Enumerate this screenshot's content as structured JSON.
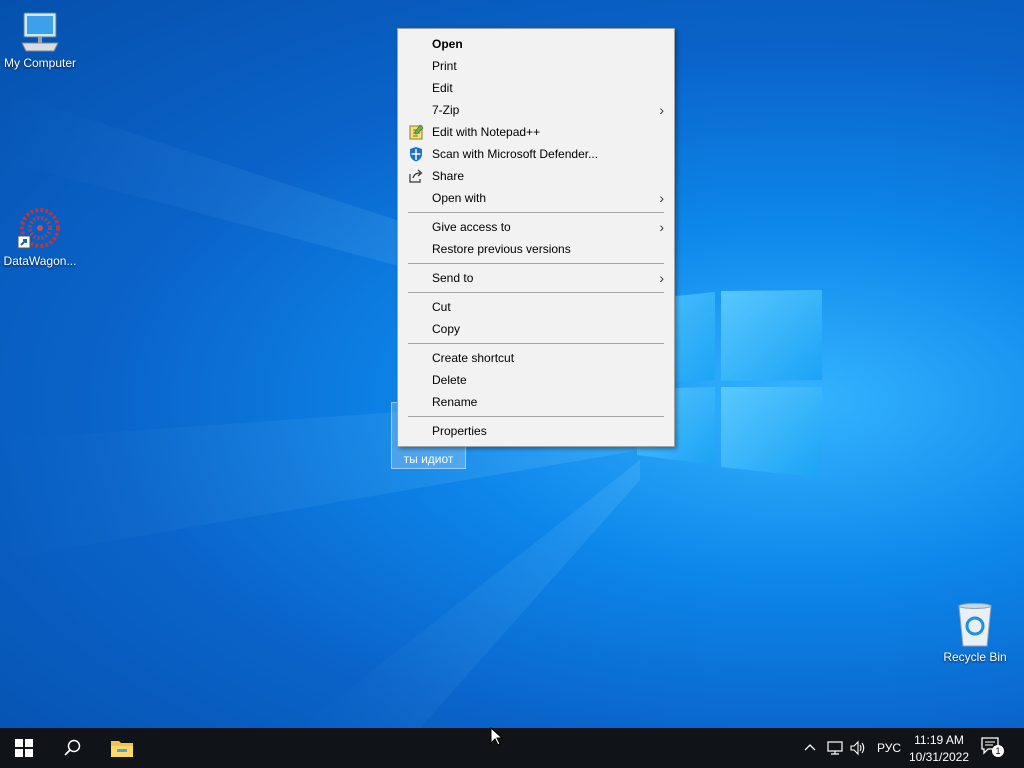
{
  "desktop": {
    "icons": [
      {
        "label": "My Computer",
        "icon": "computer-icon"
      },
      {
        "label": "DataWagon...",
        "icon": "datawagon-shortcut-icon"
      },
      {
        "label": "Recycle Bin",
        "icon": "recycle-bin-icon"
      }
    ],
    "selected_file": {
      "label": "ты идиот"
    }
  },
  "context_menu": {
    "items": [
      {
        "label": "Open",
        "bold": true
      },
      {
        "label": "Print"
      },
      {
        "label": "Edit"
      },
      {
        "label": "7-Zip",
        "submenu": true
      },
      {
        "label": "Edit with Notepad++",
        "icon": "notepad-plus-plus-icon"
      },
      {
        "label": "Scan with Microsoft Defender...",
        "icon": "defender-shield-icon"
      },
      {
        "label": "Share",
        "icon": "share-icon"
      },
      {
        "label": "Open with",
        "submenu": true
      },
      {
        "label": "Give access to",
        "submenu": true
      },
      {
        "label": "Restore previous versions"
      },
      {
        "label": "Send to",
        "submenu": true
      },
      {
        "label": "Cut"
      },
      {
        "label": "Copy"
      },
      {
        "label": "Create shortcut"
      },
      {
        "label": "Delete"
      },
      {
        "label": "Rename"
      },
      {
        "label": "Properties"
      }
    ]
  },
  "taskbar": {
    "language": "РУС",
    "time": "11:19 AM",
    "date": "10/31/2022",
    "notification_count": "1"
  },
  "colors": {
    "taskbar_bg": "#101419",
    "menu_bg": "#f2f2f2",
    "desktop_accent": "#0a63c9"
  }
}
